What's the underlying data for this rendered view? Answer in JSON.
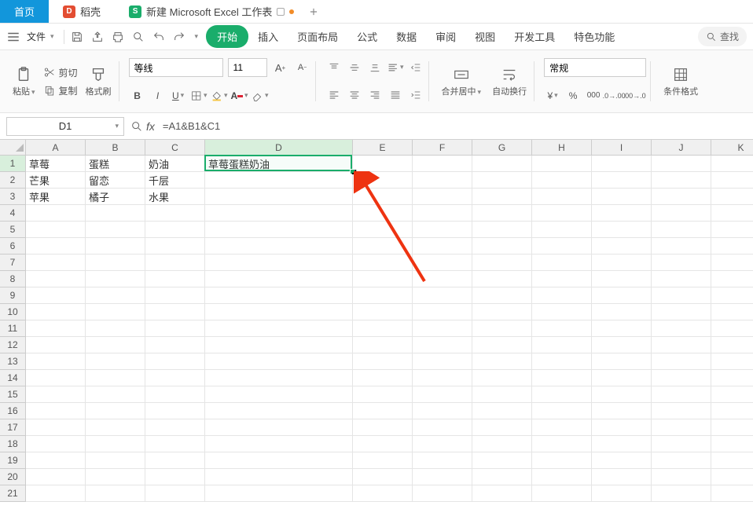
{
  "tabs": {
    "home": "首页",
    "doc2": "稻壳",
    "doc3": "新建 Microsoft Excel 工作表"
  },
  "file_label": "文件",
  "ribbon_tabs": [
    "开始",
    "插入",
    "页面布局",
    "公式",
    "数据",
    "审阅",
    "视图",
    "开发工具",
    "特色功能"
  ],
  "search_label": "查找",
  "clipboard": {
    "paste": "粘贴",
    "cut": "剪切",
    "copy": "复制",
    "format_painter": "格式刷"
  },
  "font": {
    "name": "等线",
    "size": "11"
  },
  "align": {
    "merge": "合并居中",
    "wrap": "自动换行"
  },
  "number_format": "常规",
  "cond_fmt": "条件格式",
  "name_box": "D1",
  "formula": "=A1&B1&C1",
  "columns": [
    "A",
    "B",
    "C",
    "D",
    "E",
    "F",
    "G",
    "H",
    "I",
    "J",
    "K"
  ],
  "selected_col": "D",
  "selected_row": 1,
  "row_count": 21,
  "cell_data": {
    "A1": "草莓",
    "B1": "蛋糕",
    "C1": "奶油",
    "D1": "草莓蛋糕奶油",
    "A2": "芒果",
    "B2": "留恋",
    "C2": "千层",
    "A3": "苹果",
    "B3": "橘子",
    "C3": "水果"
  },
  "col_widths": {
    "A": 76,
    "B": 76,
    "C": 76,
    "D": 188,
    "E": 76,
    "F": 76,
    "G": 76,
    "H": 76,
    "I": 76,
    "J": 76,
    "K": 76
  }
}
